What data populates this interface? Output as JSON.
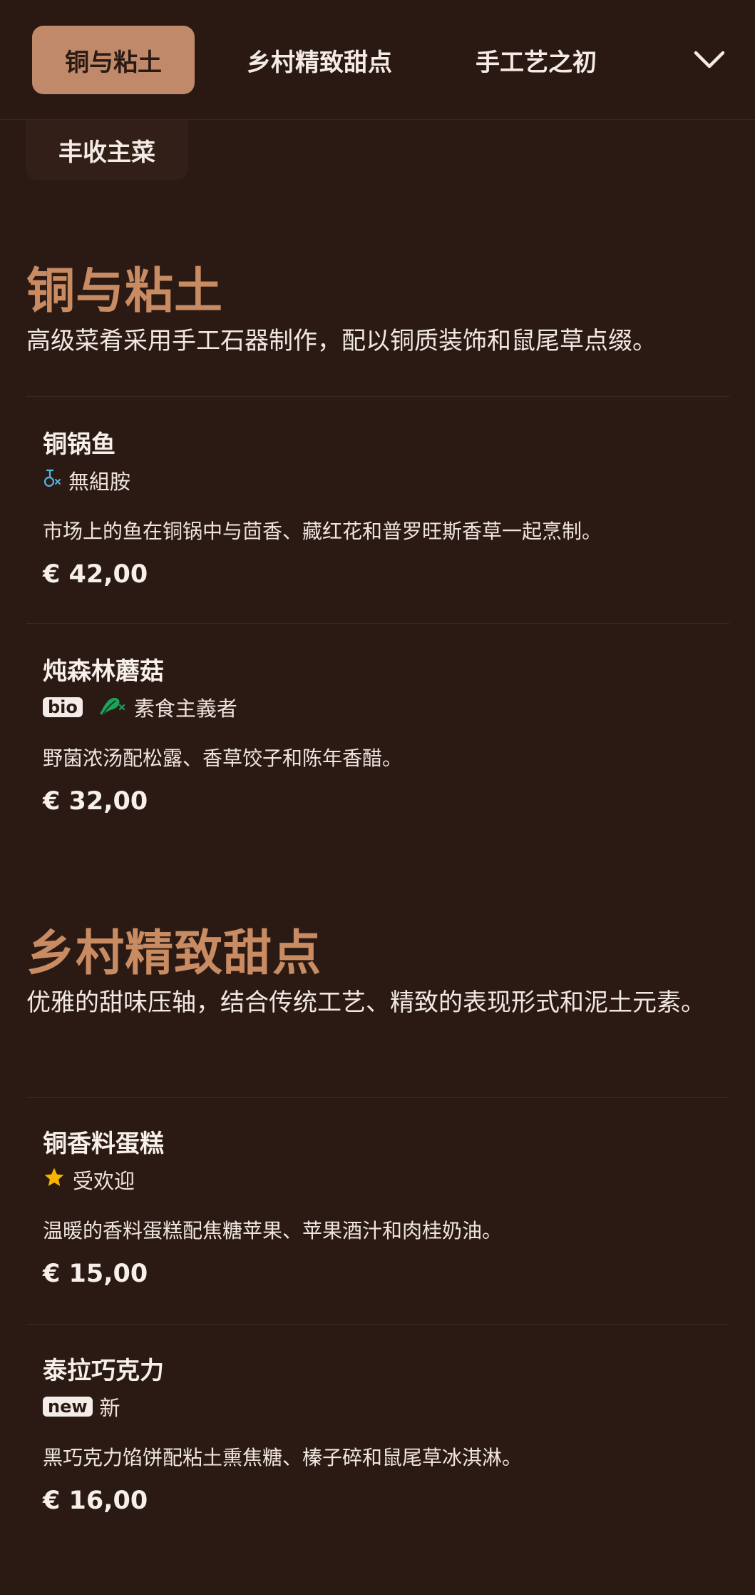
{
  "tabs": [
    {
      "label": "铜与粘土",
      "active": true
    },
    {
      "label": "乡村精致甜点",
      "active": false
    },
    {
      "label": "手工艺之初",
      "active": false
    }
  ],
  "partial_tab": {
    "label": "丰收主菜"
  },
  "icons": {
    "chevron": "chevron-down-icon",
    "histamine": "no-histamine-icon",
    "vegan": "vegan-icon",
    "star": "star-icon"
  },
  "colors": {
    "background": "#2b1a14",
    "accent": "#c08a6a",
    "title": "#c88b62",
    "vegan_green": "#1aa35a",
    "histamine_blue": "#4fb6e4",
    "star_gold": "#f5b400"
  },
  "sections": [
    {
      "title": "铜与粘土",
      "description": "高级菜肴采用手工石器制作，配以铜质装饰和鼠尾草点缀。",
      "items": [
        {
          "name": "铜锅鱼",
          "badge_label": "無組胺",
          "description": "市场上的鱼在铜锅中与茴香、藏红花和普罗旺斯香草一起烹制。",
          "price": "€ 42,00"
        },
        {
          "name": "炖森林蘑菇",
          "bio_label": "bio",
          "badge_label": "素食主義者",
          "description": "野菌浓汤配松露、香草饺子和陈年香醋。",
          "price": "€ 32,00"
        }
      ]
    },
    {
      "title": "乡村精致甜点",
      "description": "优雅的甜味压轴，结合传统工艺、精致的表现形式和泥土元素。",
      "items": [
        {
          "name": "铜香料蛋糕",
          "badge_label": "受欢迎",
          "description": "温暖的香料蛋糕配焦糖苹果、苹果酒汁和肉桂奶油。",
          "price": "€ 15,00"
        },
        {
          "name": "泰拉巧克力",
          "new_label": "new",
          "badge_label": "新",
          "description": "黑巧克力馅饼配粘土熏焦糖、榛子碎和鼠尾草冰淇淋。",
          "price": "€ 16,00"
        }
      ]
    }
  ]
}
